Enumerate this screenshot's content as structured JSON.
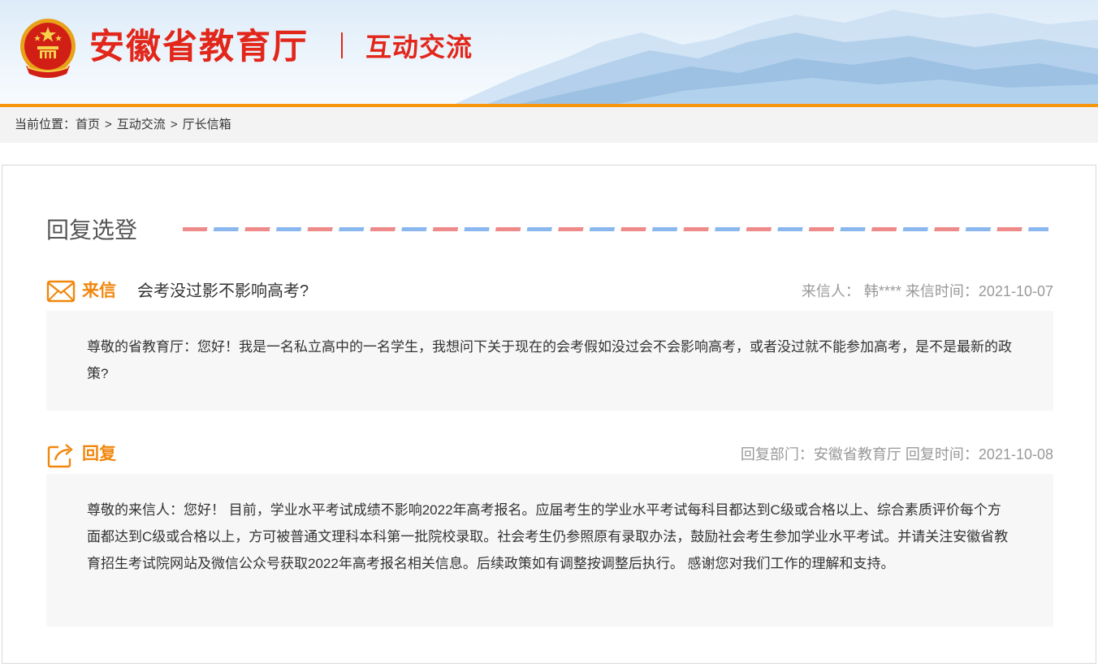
{
  "header": {
    "site_title": "安徽省教育厅",
    "section_title": "互动交流",
    "emblem_icon": "national-emblem-icon"
  },
  "breadcrumb": {
    "prefix": "当前位置：",
    "items": [
      "首页",
      "互动交流",
      "厅长信箱"
    ],
    "separator": ">"
  },
  "panel": {
    "heading": "回复选登"
  },
  "letter": {
    "icon": "envelope-icon",
    "tag": "来信",
    "subject": "会考没过影不影响高考?",
    "sender_label": "来信人：",
    "sender": "韩****",
    "time_label": "来信时间：",
    "time": "2021-10-07",
    "body": "尊敬的省教育厅：您好！我是一名私立高中的一名学生，我想问下关于现在的会考假如没过会不会影响高考，或者没过就不能参加高考，是不是最新的政策?"
  },
  "reply": {
    "icon": "reply-share-icon",
    "tag": "回复",
    "dept_label": "回复部门：",
    "dept": "安徽省教育厅",
    "time_label": "回复时间：",
    "time": "2021-10-08",
    "body": "尊敬的来信人：您好！ 目前，学业水平考试成绩不影响2022年高考报名。应届考生的学业水平考试每科目都达到C级或合格以上、综合素质评价每个方面都达到C级或合格以上，方可被普通文理科本科第一批院校录取。社会考生仍参照原有录取办法，鼓励社会考生参加学业水平考试。并请关注安徽省教育招生考试院网站及微信公众号获取2022年高考报名相关信息。后续政策如有调整按调整后执行。 感谢您对我们工作的理解和支持。"
  },
  "colors": {
    "brand_red": "#e2261a",
    "accent_orange": "#f0870d",
    "divider_orange": "#f5960d"
  }
}
